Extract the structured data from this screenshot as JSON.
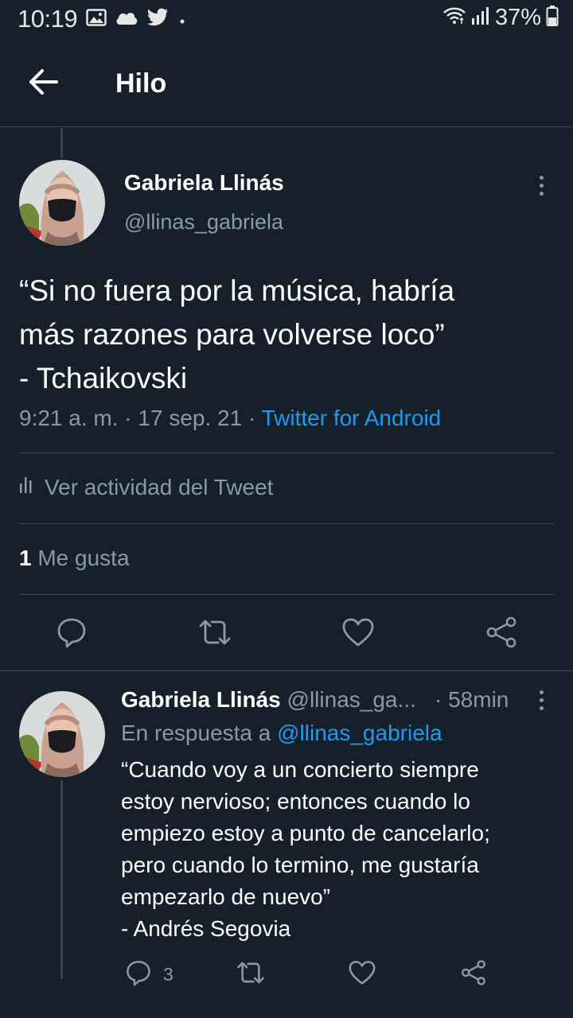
{
  "status_bar": {
    "time": "10:19",
    "battery": "37%",
    "left_icons": [
      "image-icon",
      "cloud-icon",
      "twitter-bird-icon",
      "dot-icon"
    ],
    "right_icons": [
      "wifi-icon",
      "signal-icon",
      "battery-icon"
    ]
  },
  "header": {
    "title": "Hilo"
  },
  "main_tweet": {
    "name": "Gabriela Llinás",
    "handle": "@llinas_gabriela",
    "text": "“Si no fuera por la música, habría\nmás razones para volverse loco”\n- Tchaikovski",
    "time": "9:21 a. m.",
    "separator": " · ",
    "date": "17 sep. 21",
    "source": "Twitter for Android",
    "activity_label": "Ver actividad del Tweet",
    "likes_count": "1",
    "likes_label": " Me gusta"
  },
  "reply_tweet": {
    "name": "Gabriela Llinás",
    "handle": " @llinas_ga...",
    "time": "· 58min",
    "reply_to_label": "En respuesta a ",
    "reply_to_handle": "@llinas_gabriela",
    "text": "“Cuando voy a un concierto siempre\nestoy nervioso; entonces cuando lo\nempiezo estoy a punto de cancelarlo;\npero cuando lo termino, me gustaría\nempezarlo de nuevo”\n- Andrés Segovia",
    "reply_count": "3"
  },
  "colors": {
    "background": "#15202b",
    "divider": "#38444d",
    "secondary_text": "#8b98a5",
    "accent": "#1d9bf0"
  }
}
